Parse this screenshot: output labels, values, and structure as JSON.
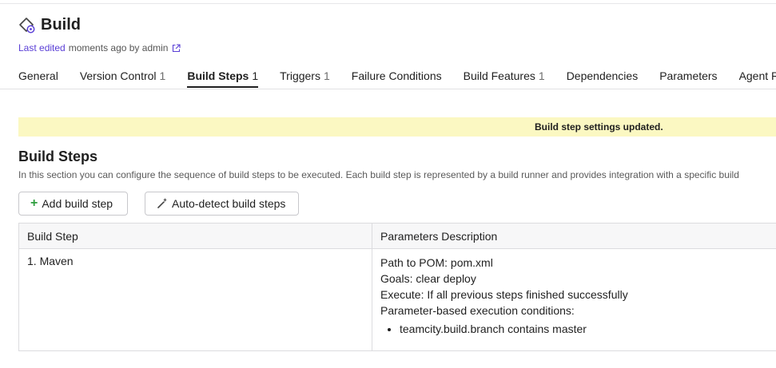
{
  "header": {
    "title": "Build",
    "icon": "build-config-icon",
    "edited_link": "Last edited",
    "edited_rest": "moments ago by admin"
  },
  "tabs": [
    {
      "label": "General",
      "count": ""
    },
    {
      "label": "Version Control",
      "count": "1"
    },
    {
      "label": "Build Steps",
      "count": "1",
      "active": true
    },
    {
      "label": "Triggers",
      "count": "1"
    },
    {
      "label": "Failure Conditions",
      "count": ""
    },
    {
      "label": "Build Features",
      "count": "1"
    },
    {
      "label": "Dependencies",
      "count": ""
    },
    {
      "label": "Parameters",
      "count": ""
    },
    {
      "label": "Agent Requ",
      "count": ""
    }
  ],
  "notice": {
    "text": "Build step settings updated."
  },
  "section": {
    "title": "Build Steps",
    "description": "In this section you can configure the sequence of build steps to be executed. Each build step is represented by a build runner and provides integration with a specific build"
  },
  "buttons": {
    "add": "Add build step",
    "autodetect": "Auto-detect build steps"
  },
  "table": {
    "headers": [
      "Build Step",
      "Parameters Description"
    ],
    "rows": [
      {
        "step": "1. Maven",
        "params": [
          "Path to POM: pom.xml",
          "Goals: clear deploy",
          "Execute: If all previous steps finished successfully",
          "Parameter-based execution conditions:"
        ],
        "conditions": [
          "teamcity.build.branch contains master"
        ]
      }
    ]
  },
  "colors": {
    "accent": "#5a3fd6",
    "notice_bg": "#fbf8c2",
    "plus": "#2e9e3e"
  }
}
